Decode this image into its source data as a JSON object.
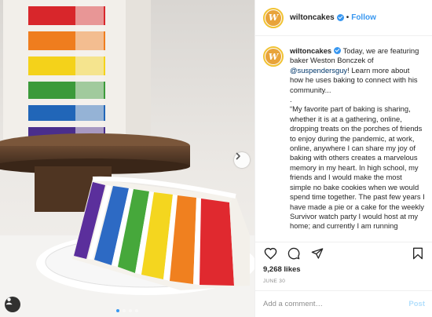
{
  "post": {
    "username": "wiltoncakes",
    "follow_label": "Follow",
    "separator": "•",
    "avatar_letter": "W",
    "caption": {
      "intro": "Today, we are featuring baker Weston Bonczek of",
      "mention": "@suspendersguy",
      "after_mention": "! Learn more about how he uses baking to connect with his community...",
      "dot": ".",
      "quote": "“My favorite part of baking is sharing, whether it is at a gathering, online, dropping treats on the porches of friends to enjoy during the pandemic, at work, online, anywhere I can share my joy of baking with others creates a marvelous memory in my heart. In high school, my friends and I would make the most simple no bake cookies when we would spend time together. The past few years I have made a pie or a cake for the weekly Survivor watch party I would host at my home; and currently I am running"
    },
    "likes": "9,268 likes",
    "date": "JUNE 30",
    "comment_placeholder": "Add a comment…",
    "post_label": "Post"
  },
  "carousel": {
    "slide_count": 4,
    "active_index": 0
  },
  "colors": {
    "accent": "#3897f0",
    "avatar_ring": "#f1c232",
    "avatar_fill": "#e8a33a"
  },
  "icons": [
    "heart-icon",
    "comment-icon",
    "share-icon",
    "bookmark-icon",
    "verified-icon",
    "chevron-right-icon",
    "user-tag-icon"
  ]
}
